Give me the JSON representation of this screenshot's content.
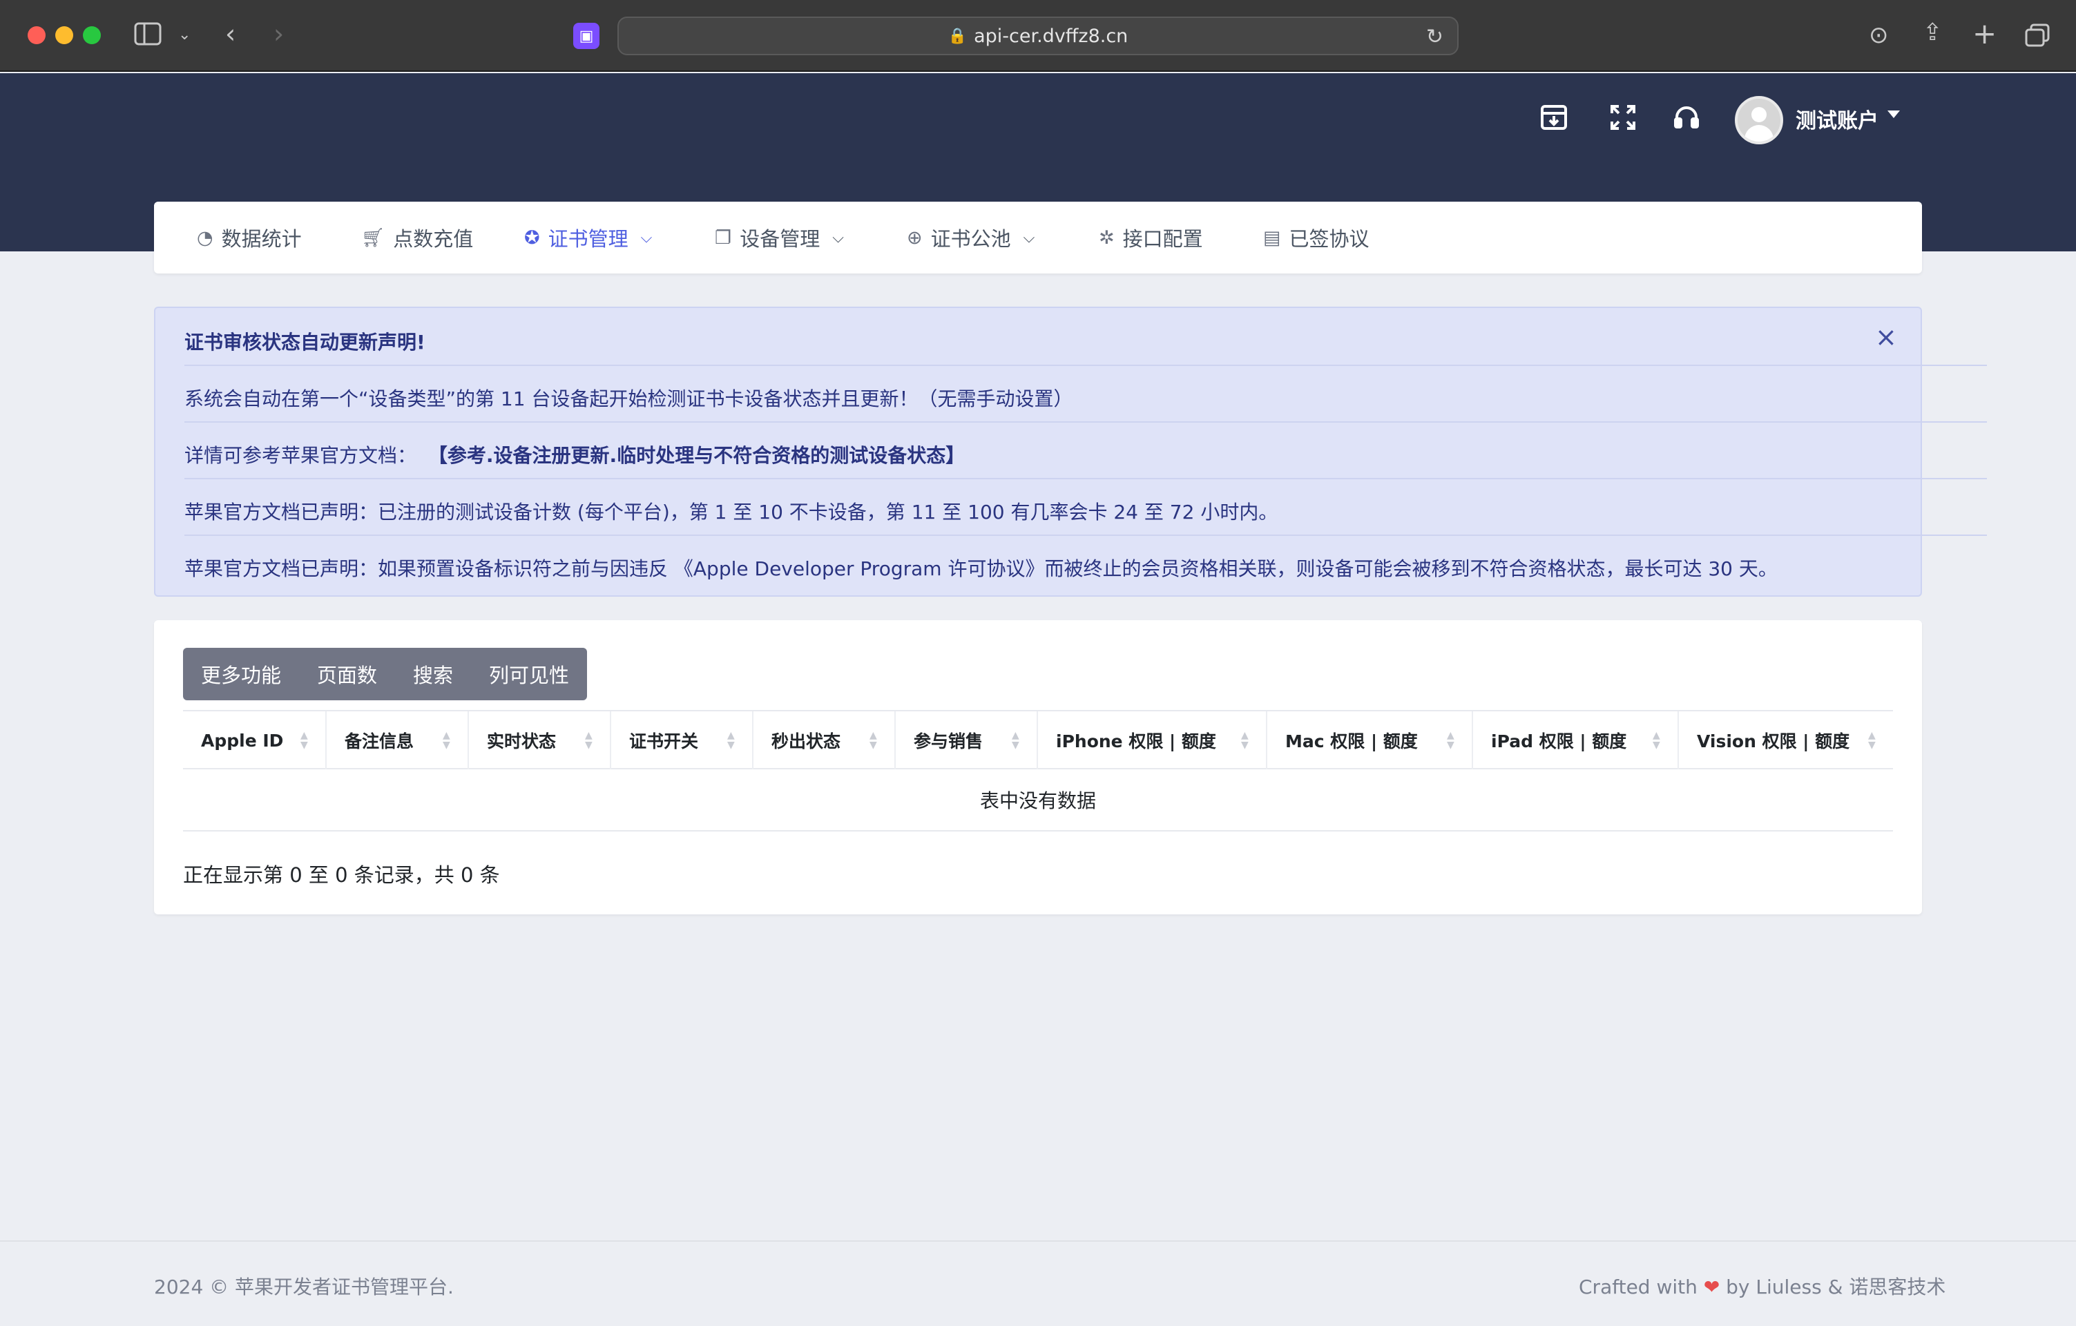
{
  "browser": {
    "url": "api-cer.dvffz8.cn",
    "icons": [
      "sidebar-icon",
      "chevron-down-icon",
      "back-icon",
      "forward-icon",
      "lock-icon",
      "reload-icon",
      "download-icon",
      "share-icon",
      "plus-icon",
      "tabs-icon",
      "extension-icon"
    ]
  },
  "header": {
    "username": "测试账户",
    "icons": [
      "archive-icon",
      "fullscreen-icon",
      "headset-icon",
      "avatar-icon"
    ]
  },
  "nav": {
    "items": [
      {
        "label": "数据统计",
        "icon": "chart-pie-icon",
        "active": false,
        "dropdown": false
      },
      {
        "label": "点数充值",
        "icon": "cart-icon",
        "active": false,
        "dropdown": false
      },
      {
        "label": "证书管理",
        "icon": "certificate-icon",
        "active": true,
        "dropdown": true
      },
      {
        "label": "设备管理",
        "icon": "devices-icon",
        "active": false,
        "dropdown": true
      },
      {
        "label": "证书公池",
        "icon": "plus-circle-icon",
        "active": false,
        "dropdown": true
      },
      {
        "label": "接口配置",
        "icon": "puzzle-icon",
        "active": false,
        "dropdown": false
      },
      {
        "label": "已签协议",
        "icon": "document-icon",
        "active": false,
        "dropdown": false
      }
    ],
    "active_color": "#4f5fe0"
  },
  "alert": {
    "title": "证书审核状态自动更新声明!",
    "line1": "系统会自动在第一个“设备类型”的第 11 台设备起开始检测证书卡设备状态并且更新！（无需手动设置）",
    "line2_prefix": "详情可参考苹果官方文档：",
    "line2_link": "【参考.设备注册更新.临时处理与不符合资格的测试设备状态】",
    "line3": "苹果官方文档已声明：已注册的测试设备计数 (每个平台)，第 1 至 10 不卡设备，第 11 至 100 有几率会卡 24 至 72 小时内。",
    "line4": "苹果官方文档已声明：如果预置设备标识符之前与因违反 《Apple Developer Program 许可协议》而被终止的会员资格相关联，则设备可能会被移到不符合资格状态，最长可达 30 天。",
    "close": "×"
  },
  "table": {
    "buttons": [
      "更多功能",
      "页面数",
      "搜索",
      "列可见性"
    ],
    "columns": [
      "Apple ID",
      "备注信息",
      "实时状态",
      "证书开关",
      "秒出状态",
      "参与销售",
      "iPhone 权限 | 额度",
      "Mac 权限 | 额度",
      "iPad 权限 | 额度",
      "Vision 权限 | 额度"
    ],
    "empty_text": "表中没有数据",
    "info": "正在显示第 0 至 0 条记录，共 0 条"
  },
  "footer": {
    "left": "2024 © 苹果开发者证书管理平台.",
    "right_prefix": "Crafted with",
    "heart": "❤",
    "right_suffix": "by Liuless & 诺思客技术"
  },
  "colors": {
    "header_bg": "#2b344f",
    "alert_bg": "#dfe3f8",
    "button_group_bg": "#717585",
    "page_bg": "#eceef3"
  }
}
